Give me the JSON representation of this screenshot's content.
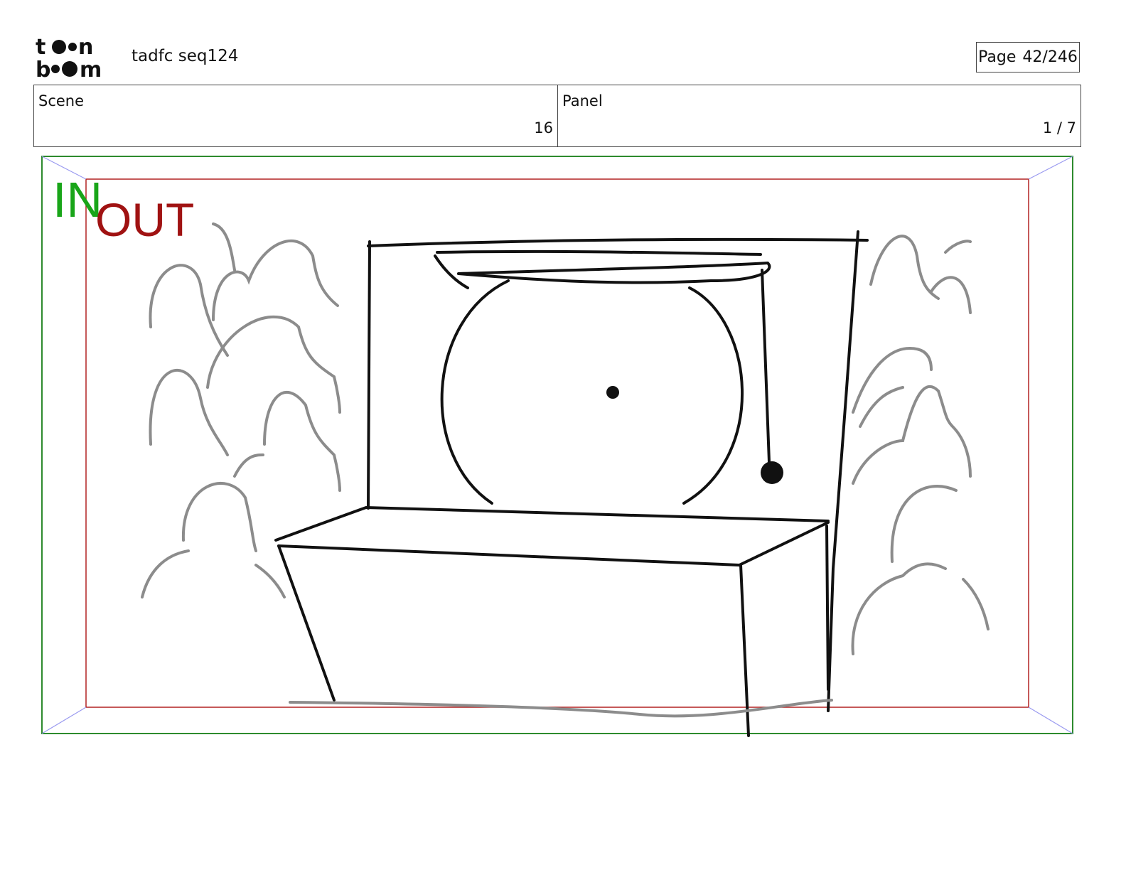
{
  "header": {
    "logo_text": "toon boom",
    "project_title": "tadfc seq124",
    "page_label": "Page",
    "page_value": "42/246"
  },
  "info": {
    "scene_label": "Scene",
    "scene_value": "16",
    "panel_label": "Panel",
    "panel_value": "1 / 7"
  },
  "frame": {
    "in_label": "IN",
    "out_label": "OUT",
    "in_color": "#19a519",
    "out_color": "#a01212"
  },
  "drawing": {
    "description_elements": [
      "gong",
      "table",
      "crowd-left",
      "crowd-right"
    ]
  }
}
